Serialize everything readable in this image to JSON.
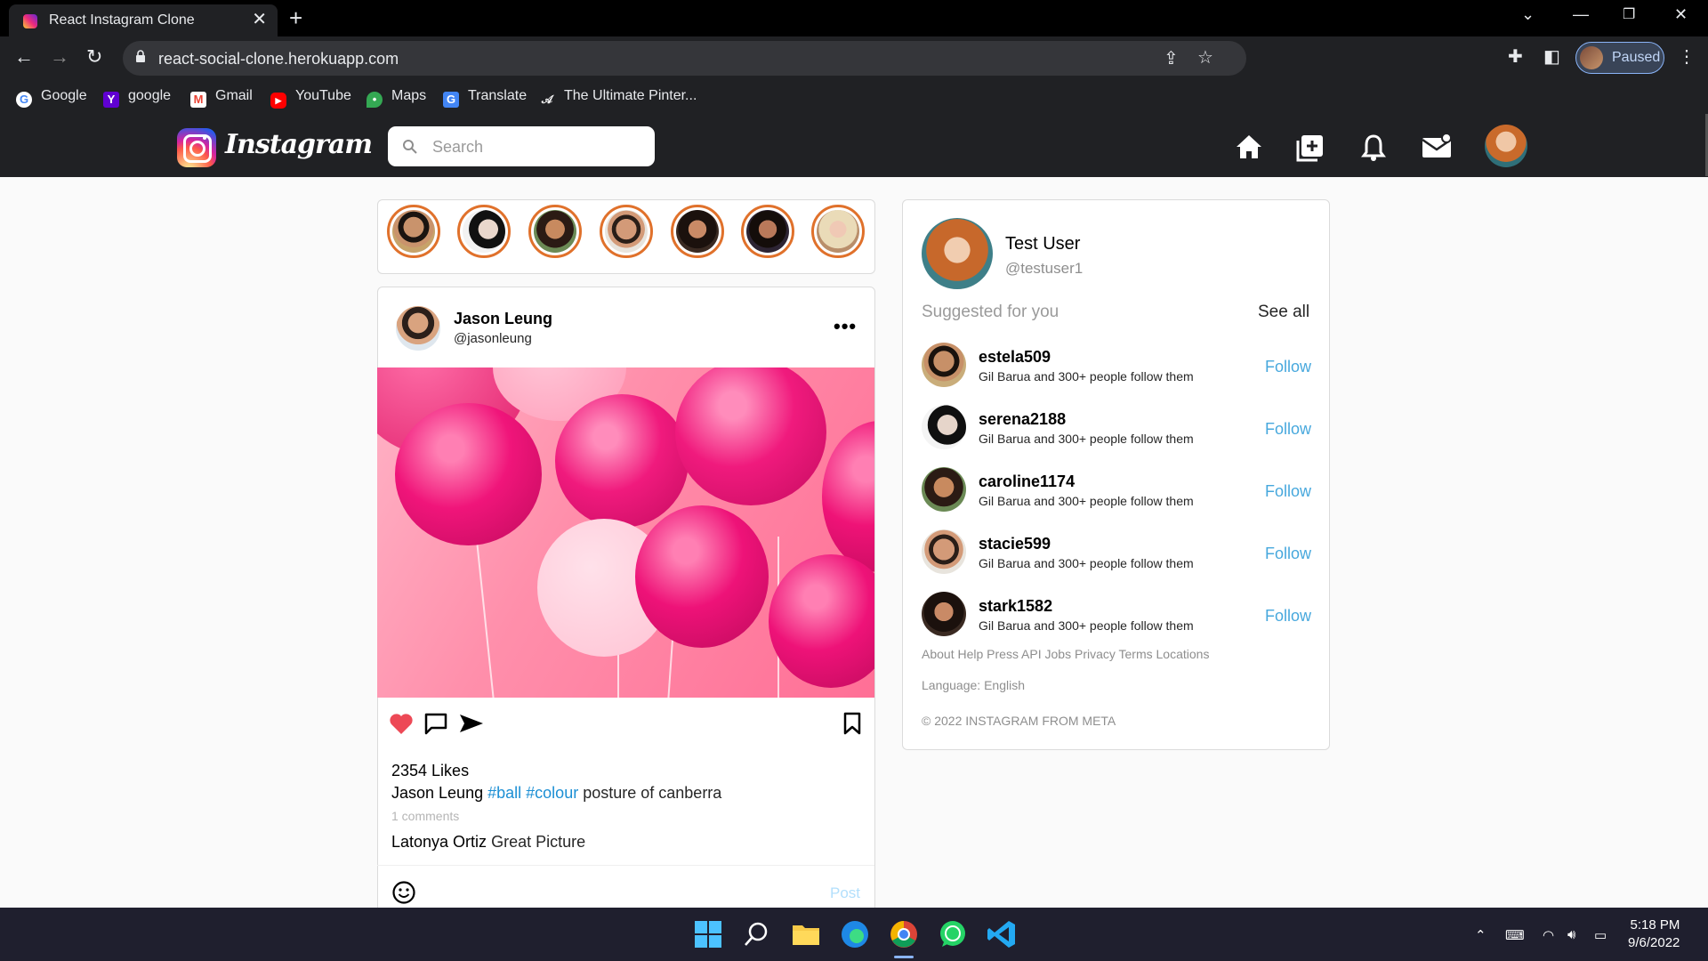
{
  "browser": {
    "tab_title": "React Instagram Clone",
    "url": "react-social-clone.herokuapp.com",
    "profile_label": "Paused",
    "bookmarks": [
      "Google",
      "google",
      "Gmail",
      "YouTube",
      "Maps",
      "Translate",
      "The Ultimate Pinter..."
    ]
  },
  "header": {
    "brand": "Instagram",
    "search_placeholder": "Search",
    "icons": [
      "home-icon",
      "add-post-icon",
      "bell-icon",
      "mail-icon",
      "profile-avatar"
    ]
  },
  "stories": [
    "story-1",
    "story-2",
    "story-3",
    "story-4",
    "story-5",
    "story-6",
    "story-7"
  ],
  "post": {
    "author_name": "Jason Leung",
    "author_handle": "@jasonleung",
    "more": "•••",
    "likes": "2354 Likes",
    "caption_user": "Jason Leung",
    "tag1": "#ball",
    "tag2": "#colour",
    "caption_text": "posture of canberra",
    "comments_count": "1 comments",
    "comment_user": "Latonya Ortiz",
    "comment_text": "Great Picture",
    "post_button": "Post",
    "liked": true,
    "colors": {
      "like": "#ed4956",
      "tag": "#1c8fd4",
      "follow": "#47a8dd"
    }
  },
  "sidebar": {
    "user_name": "Test User",
    "user_handle": "@testuser1",
    "suggested_title": "Suggested for you",
    "see_all": "See all",
    "suggestions": [
      {
        "username": "estela509",
        "subtitle": "Gil Barua and 300+ people follow them",
        "action": "Follow"
      },
      {
        "username": "serena2188",
        "subtitle": "Gil Barua and 300+ people follow them",
        "action": "Follow"
      },
      {
        "username": "caroline1174",
        "subtitle": "Gil Barua and 300+ people follow them",
        "action": "Follow"
      },
      {
        "username": "stacie599",
        "subtitle": "Gil Barua and 300+ people follow them",
        "action": "Follow"
      },
      {
        "username": "stark1582",
        "subtitle": "Gil Barua and 300+ people follow them",
        "action": "Follow"
      }
    ],
    "footer_links": "About Help Press API Jobs Privacy Terms Locations",
    "language": "Language: English",
    "copyright": "© 2022 INSTAGRAM FROM META"
  },
  "taskbar": {
    "time": "5:18 PM",
    "date": "9/6/2022"
  }
}
